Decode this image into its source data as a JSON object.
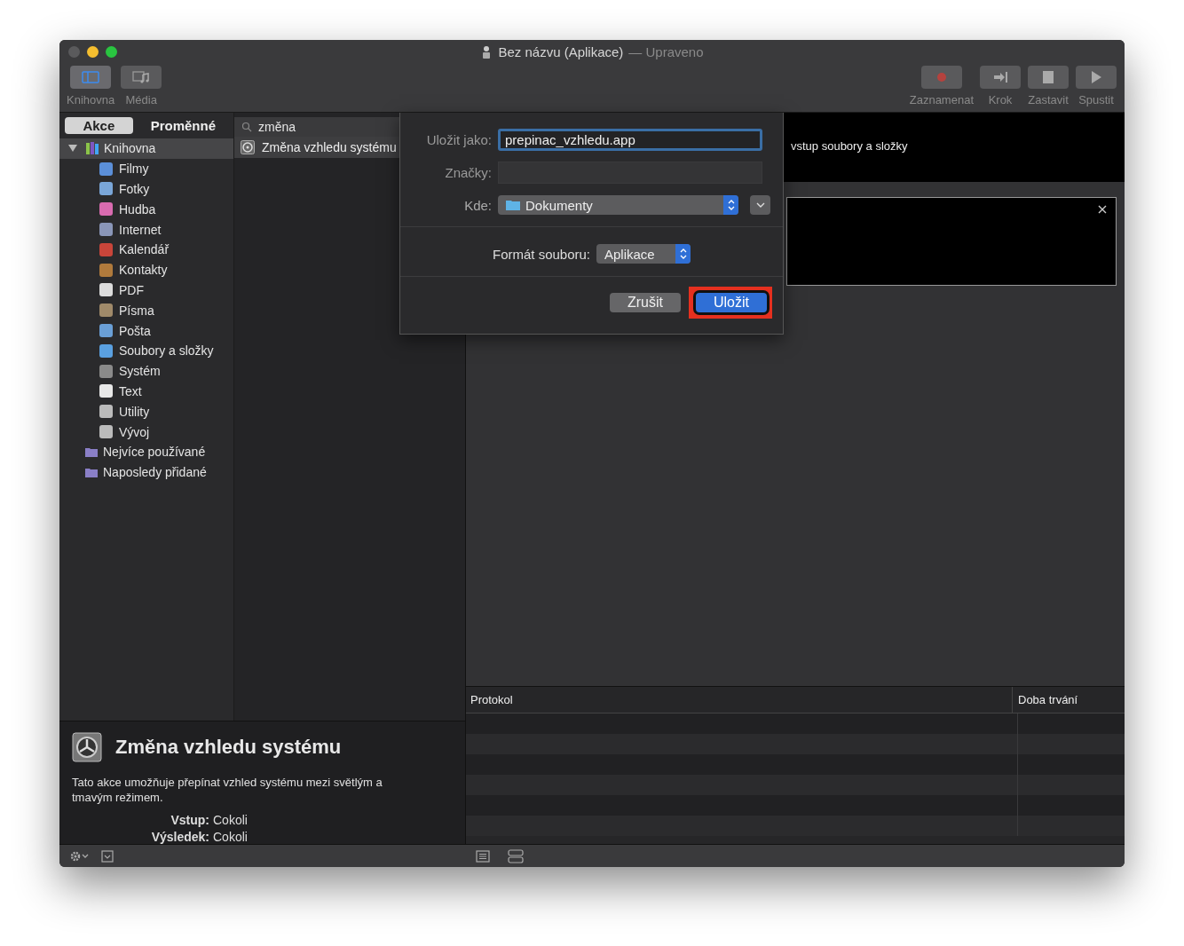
{
  "window": {
    "title": "Bez názvu (Aplikace)",
    "subtitle": "— Upraveno"
  },
  "toolbar": {
    "left": [
      {
        "label": "Knihovna",
        "selected": true
      },
      {
        "label": "Média",
        "selected": false
      }
    ],
    "right": [
      {
        "label": "Zaznamenat"
      },
      {
        "label": "Krok"
      },
      {
        "label": "Zastavit"
      },
      {
        "label": "Spustit"
      }
    ]
  },
  "library": {
    "tabs": [
      {
        "label": "Akce",
        "selected": true
      },
      {
        "label": "Proměnné",
        "selected": false
      }
    ],
    "search": {
      "value": "změna"
    },
    "tree": [
      {
        "label": "Knihovna",
        "selected": true,
        "expanded": true,
        "children": [
          {
            "label": "Filmy"
          },
          {
            "label": "Fotky"
          },
          {
            "label": "Hudba"
          },
          {
            "label": "Internet"
          },
          {
            "label": "Kalendář"
          },
          {
            "label": "Kontakty"
          },
          {
            "label": "PDF"
          },
          {
            "label": "Písma"
          },
          {
            "label": "Pošta"
          },
          {
            "label": "Soubory a složky"
          },
          {
            "label": "Systém"
          },
          {
            "label": "Text"
          },
          {
            "label": "Utility"
          },
          {
            "label": "Vývoj"
          }
        ]
      },
      {
        "label": "Nejvíce používané",
        "selected": false
      },
      {
        "label": "Naposledy přidané",
        "selected": false
      }
    ],
    "results": [
      {
        "label": "Změna vzhledu systému",
        "selected": true
      }
    ]
  },
  "info": {
    "title": "Změna vzhledu systému",
    "description": "Tato akce umožňuje přepínat vzhled systému mezi světlým a tmavým režimem.",
    "fields": [
      {
        "label": "Vstup:",
        "value": "Cokoli"
      },
      {
        "label": "Výsledek:",
        "value": "Cokoli"
      }
    ]
  },
  "workflow": {
    "input_text": "vstup soubory a složky"
  },
  "log": {
    "columns": [
      "Protokol",
      "Doba trvání"
    ]
  },
  "dialog": {
    "save_as_label": "Uložit jako:",
    "save_as_value": "prepinac_vzhledu.app",
    "tags_label": "Značky:",
    "where_label": "Kde:",
    "where_value": "Dokumenty",
    "format_label": "Formát souboru:",
    "format_value": "Aplikace",
    "buttons": [
      {
        "label": "Zrušit",
        "kind": "secondary",
        "highlighted": false
      },
      {
        "label": "Uložit",
        "kind": "primary",
        "highlighted": true
      }
    ]
  }
}
